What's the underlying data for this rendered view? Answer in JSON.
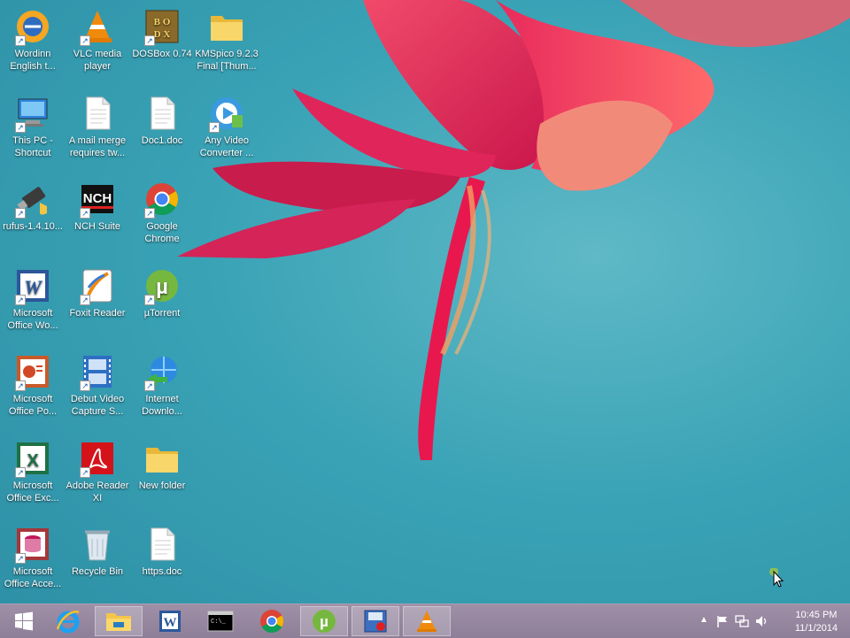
{
  "desktop": {
    "icons": [
      {
        "label": "Wordinn\nEnglish t...",
        "icon": "wordinn-icon"
      },
      {
        "label": "VLC media\nplayer",
        "icon": "vlc-icon"
      },
      {
        "label": "DOSBox 0.74",
        "icon": "dosbox-icon"
      },
      {
        "label": "KMSpico 9.2.3\nFinal [Thum...",
        "icon": "folder-icon"
      },
      {
        "label": "This PC -\nShortcut",
        "icon": "computer-icon"
      },
      {
        "label": "A mail merge\nrequires tw...",
        "icon": "document-icon"
      },
      {
        "label": "Doc1.doc",
        "icon": "document-icon"
      },
      {
        "label": "Any Video\nConverter ...",
        "icon": "video-converter-icon"
      },
      {
        "label": "rufus-1.4.10...",
        "icon": "usb-drive-icon"
      },
      {
        "label": "NCH Suite",
        "icon": "nch-icon"
      },
      {
        "label": "Google\nChrome",
        "icon": "chrome-icon"
      },
      {
        "label": "Microsoft\nOffice Wo...",
        "icon": "word-icon"
      },
      {
        "label": "Foxit Reader",
        "icon": "foxit-icon"
      },
      {
        "label": "µTorrent",
        "icon": "utorrent-icon"
      },
      {
        "label": "Microsoft\nOffice Po...",
        "icon": "powerpoint-icon"
      },
      {
        "label": "Debut Video\nCapture S...",
        "icon": "film-icon"
      },
      {
        "label": "Internet\nDownlo...",
        "icon": "idm-icon"
      },
      {
        "label": "Microsoft\nOffice Exc...",
        "icon": "excel-icon"
      },
      {
        "label": "Adobe Reader\nXI",
        "icon": "adobe-reader-icon"
      },
      {
        "label": "New folder",
        "icon": "folder-icon"
      },
      {
        "label": "Microsoft\nOffice Acce...",
        "icon": "access-icon"
      },
      {
        "label": "Recycle Bin",
        "icon": "recycle-bin-icon"
      },
      {
        "label": "https.doc",
        "icon": "document-icon"
      }
    ]
  },
  "taskbar": {
    "items": [
      "start-icon",
      "ie-icon",
      "file-explorer-icon",
      "word-icon",
      "cmd-icon",
      "chrome-icon",
      "utorrent-icon",
      "debut-capture-icon",
      "vlc-icon"
    ],
    "clock": {
      "time": "10:45 PM",
      "date": "11/1/2014"
    }
  },
  "colors": {
    "desktop": "#3aa3b6",
    "taskbar": "#95869d",
    "flower": "#e0305a"
  }
}
